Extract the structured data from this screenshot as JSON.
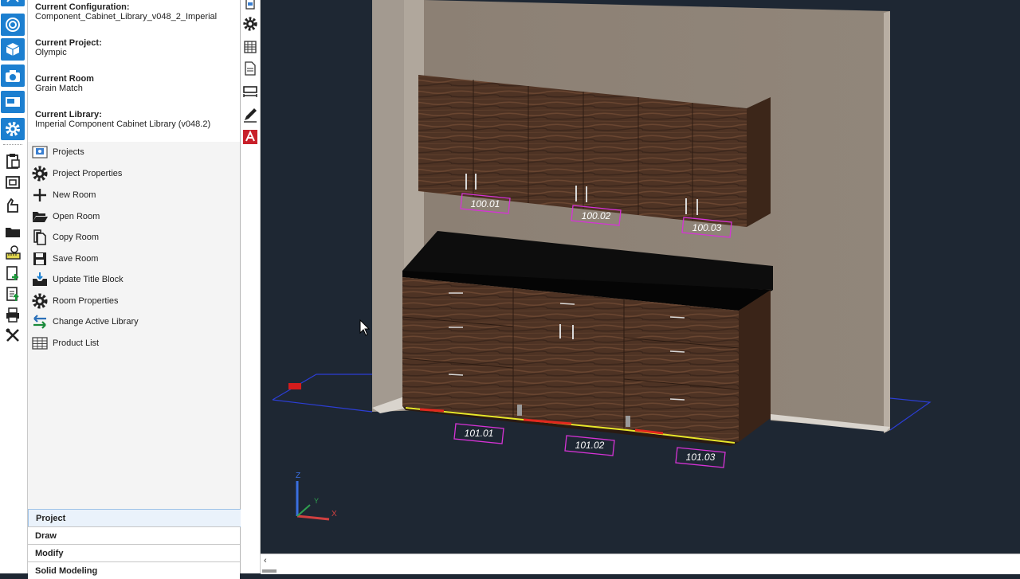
{
  "app": {
    "colors": {
      "accent": "#1c7fd0",
      "viewport_background": "#1e2733",
      "wood": "#4e3324",
      "countertop": "#0d0d0d",
      "wall": "#8f8377",
      "label_outline": "#d633d6",
      "footprint_outline": "#2c3ed6"
    }
  },
  "left_toolbar": {
    "icons": [
      "logo-icon",
      "spiral-icon",
      "cube-icon",
      "camera-icon",
      "screen-icon",
      "gear-icon",
      "clipboard-icon",
      "frame-icon",
      "hand-icon",
      "folder-icon",
      "ruler-icon",
      "add-sheet-icon",
      "export-sheet-icon",
      "printer-icon",
      "tools-icon"
    ]
  },
  "info": {
    "configuration_label": "Current Configuration:",
    "configuration_value": "Component_Cabinet_Library_v048_2_Imperial",
    "project_label": "Current Project:",
    "project_value": "Olympic",
    "room_label": "Current Room",
    "room_value": "Grain Match",
    "library_label": "Current Library:",
    "library_value": "Imperial Component Cabinet Library (v048.2)"
  },
  "menu": {
    "items": [
      {
        "label": "Projects",
        "icon": "projects-icon"
      },
      {
        "label": "Project Properties",
        "icon": "gear-icon"
      },
      {
        "label": "New Room",
        "icon": "plus-icon"
      },
      {
        "label": "Open Room",
        "icon": "folder-open-icon"
      },
      {
        "label": "Copy Room",
        "icon": "copy-icon"
      },
      {
        "label": "Save Room",
        "icon": "save-icon"
      },
      {
        "label": "Update Title Block",
        "icon": "tray-icon"
      },
      {
        "label": "Room Properties",
        "icon": "gear-icon"
      },
      {
        "label": "Change Active Library",
        "icon": "swap-arrows-icon"
      },
      {
        "label": "Product List",
        "icon": "grid-icon"
      }
    ]
  },
  "sections": {
    "tabs": [
      {
        "label": "Project",
        "active": true
      },
      {
        "label": "Draw",
        "active": false
      },
      {
        "label": "Modify",
        "active": false
      },
      {
        "label": "Solid Modeling",
        "active": false
      }
    ]
  },
  "mid_toolbar": {
    "icons": [
      "document-icon",
      "gear-icon",
      "table-icon",
      "page-icon",
      "dimension-icon",
      "pencil-icon",
      "autocad-icon"
    ]
  },
  "viewport": {
    "upper_labels": [
      "100.01",
      "100.02",
      "100.03"
    ],
    "lower_labels": [
      "101.01",
      "101.02",
      "101.03"
    ],
    "axis_labels": {
      "z": "Z",
      "y": "Y",
      "x": "X"
    }
  },
  "scrollbar": {
    "left_arrow": "‹"
  }
}
